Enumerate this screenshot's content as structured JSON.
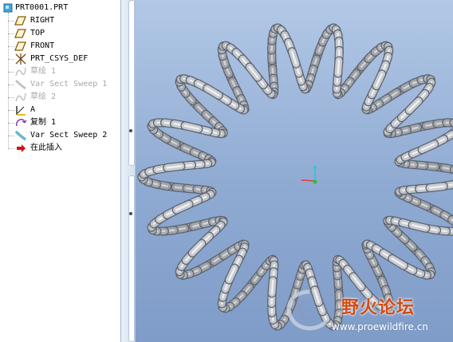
{
  "model_tree": {
    "root": "PRT0001.PRT",
    "items": [
      {
        "label": "RIGHT",
        "icon": "datum-plane-icon",
        "disabled": false
      },
      {
        "label": "TOP",
        "icon": "datum-plane-icon",
        "disabled": false
      },
      {
        "label": "FRONT",
        "icon": "datum-plane-icon",
        "disabled": false
      },
      {
        "label": "PRT_CSYS_DEF",
        "icon": "csys-icon",
        "disabled": false
      },
      {
        "label": "草绘 1",
        "icon": "sketch-icon",
        "disabled": true
      },
      {
        "label": "Var Sect Sweep 1",
        "icon": "sweep-icon",
        "disabled": true
      },
      {
        "label": "草绘 2",
        "icon": "sketch-icon",
        "disabled": true
      },
      {
        "label": "A",
        "icon": "axis-icon",
        "disabled": false
      },
      {
        "label": "复制 1",
        "icon": "copy-icon",
        "disabled": false
      },
      {
        "label": "Var Sect Sweep 2",
        "icon": "sweep-icon",
        "disabled": false
      },
      {
        "label": "在此插入",
        "icon": "insert-here-arrow-icon",
        "disabled": false
      }
    ]
  },
  "viewport": {
    "model": "spring-torus",
    "background_top": "#b2c8e6",
    "background_bottom": "#7f9cc8"
  },
  "watermark": {
    "name": "野火论坛",
    "url": "www.proewildfire.cn"
  },
  "colors": {
    "tube": "#b4b8bd",
    "axis_x": "#e03a3a",
    "axis_y": "#2ec4d8",
    "axis_z": "#28c23a",
    "insert_arrow": "#d41111"
  }
}
